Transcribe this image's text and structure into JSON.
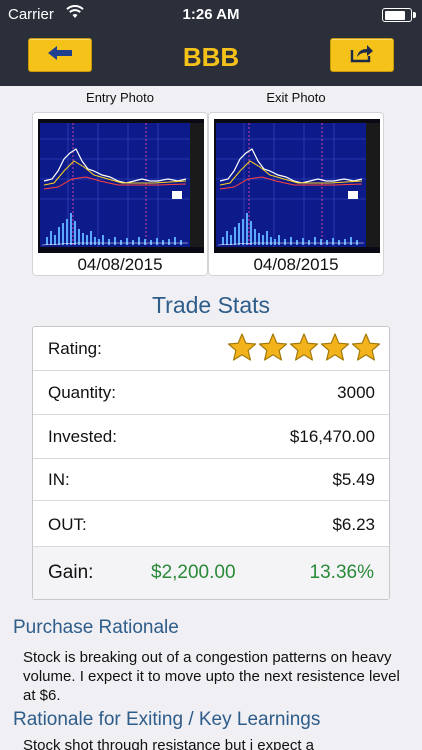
{
  "status": {
    "carrier": "Carrier",
    "time": "1:26 AM",
    "battery_level": 0.8
  },
  "nav": {
    "title": "BBB",
    "back_icon": "left-arrow-icon",
    "share_icon": "share-icon",
    "accent": "#f5c21a"
  },
  "photos": {
    "entry": {
      "label": "Entry Photo",
      "date": "04/08/2015"
    },
    "exit": {
      "label": "Exit Photo",
      "date": "04/08/2015"
    }
  },
  "trade_stats": {
    "title": "Trade Stats",
    "rating": {
      "label": "Rating:",
      "stars": 5,
      "max_stars": 5
    },
    "quantity": {
      "label": "Quantity:",
      "value": "3000"
    },
    "invested": {
      "label": "Invested:",
      "value": "$16,470.00"
    },
    "in": {
      "label": "IN:",
      "value": "$5.49"
    },
    "out": {
      "label": "OUT:",
      "value": "$6.23"
    },
    "gain": {
      "label": "Gain:",
      "amount": "$2,200.00",
      "percent": "13.36%"
    }
  },
  "purchase_rationale": {
    "title": "Purchase Rationale",
    "text": "Stock is breaking out of a congestion patterns on heavy volume. I expect it to move upto the next resistence level at $6."
  },
  "exit_rationale": {
    "title": "Rationale for Exiting / Key Learnings",
    "text": "Stock shot through resistance but i expect a"
  }
}
